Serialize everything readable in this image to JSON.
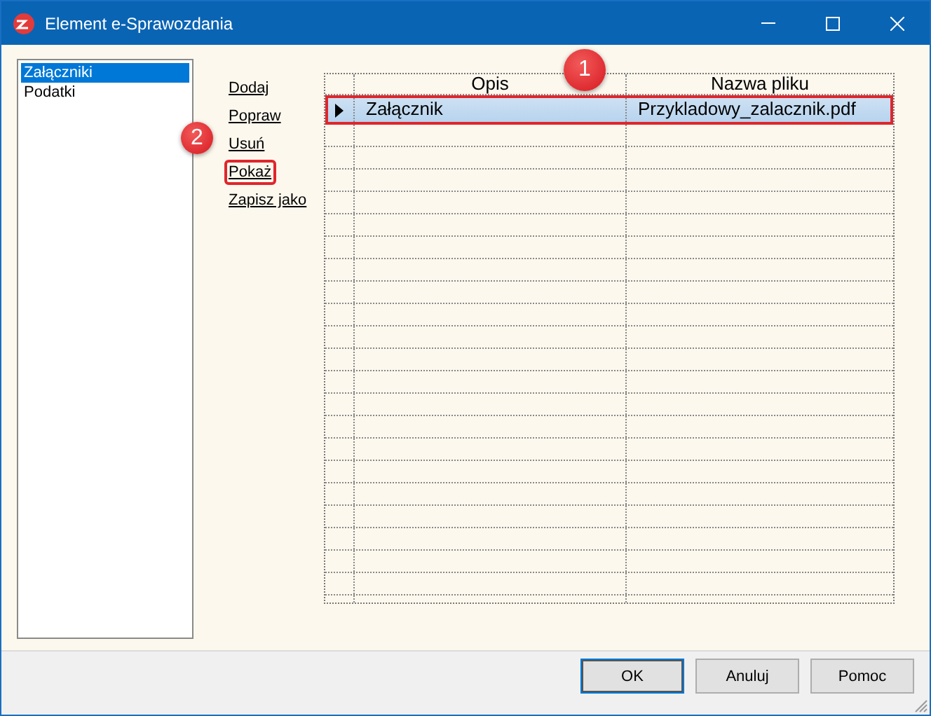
{
  "window": {
    "title": "Element e-Sprawozdania"
  },
  "sidebar": {
    "items": [
      {
        "label": "Załączniki",
        "selected": true
      },
      {
        "label": "Podatki",
        "selected": false
      }
    ]
  },
  "actions": [
    {
      "label": "Dodaj",
      "highlighted": false
    },
    {
      "label": "Popraw",
      "highlighted": false
    },
    {
      "label": "Usuń",
      "highlighted": false
    },
    {
      "label": "Pokaż",
      "highlighted": true
    },
    {
      "label": "Zapisz jako",
      "highlighted": false
    }
  ],
  "table": {
    "columns": [
      "Opis",
      "Nazwa pliku"
    ],
    "rows": [
      {
        "cells": [
          "Załącznik",
          "Przykladowy_zalacznik.pdf"
        ],
        "selected": true,
        "highlighted": true
      }
    ]
  },
  "annotations": [
    {
      "number": "1"
    },
    {
      "number": "2"
    }
  ],
  "buttons": [
    "OK",
    "Anuluj",
    "Pomoc"
  ]
}
